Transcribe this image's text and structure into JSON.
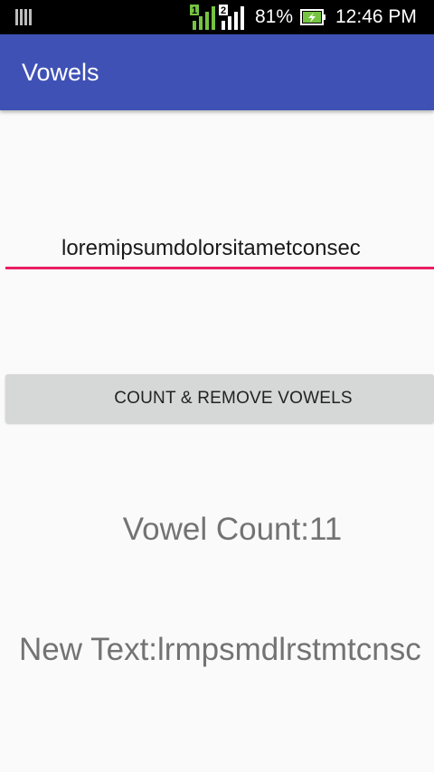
{
  "status_bar": {
    "battery_percent": "81%",
    "time": "12:46 PM",
    "icons": [
      "sim-card-icon",
      "signal-sim1-icon",
      "signal-sim2-icon",
      "battery-charging-icon"
    ],
    "sim1_label": "1",
    "sim2_label": "2",
    "colors": {
      "background": "#000000",
      "sim1_accent": "#76c442",
      "battery_fill": "#76c442"
    }
  },
  "app_bar": {
    "title": "Vowels",
    "color": "#3f51b5"
  },
  "input": {
    "value": "loremipsumdolorsitametconsec",
    "underline_color": "#e91e63"
  },
  "button": {
    "label": "COUNT & REMOVE VOWELS"
  },
  "results": {
    "vowel_count": "Vowel Count:11",
    "new_text": "New Text:lrmpsmdlrstmtcnsc"
  }
}
